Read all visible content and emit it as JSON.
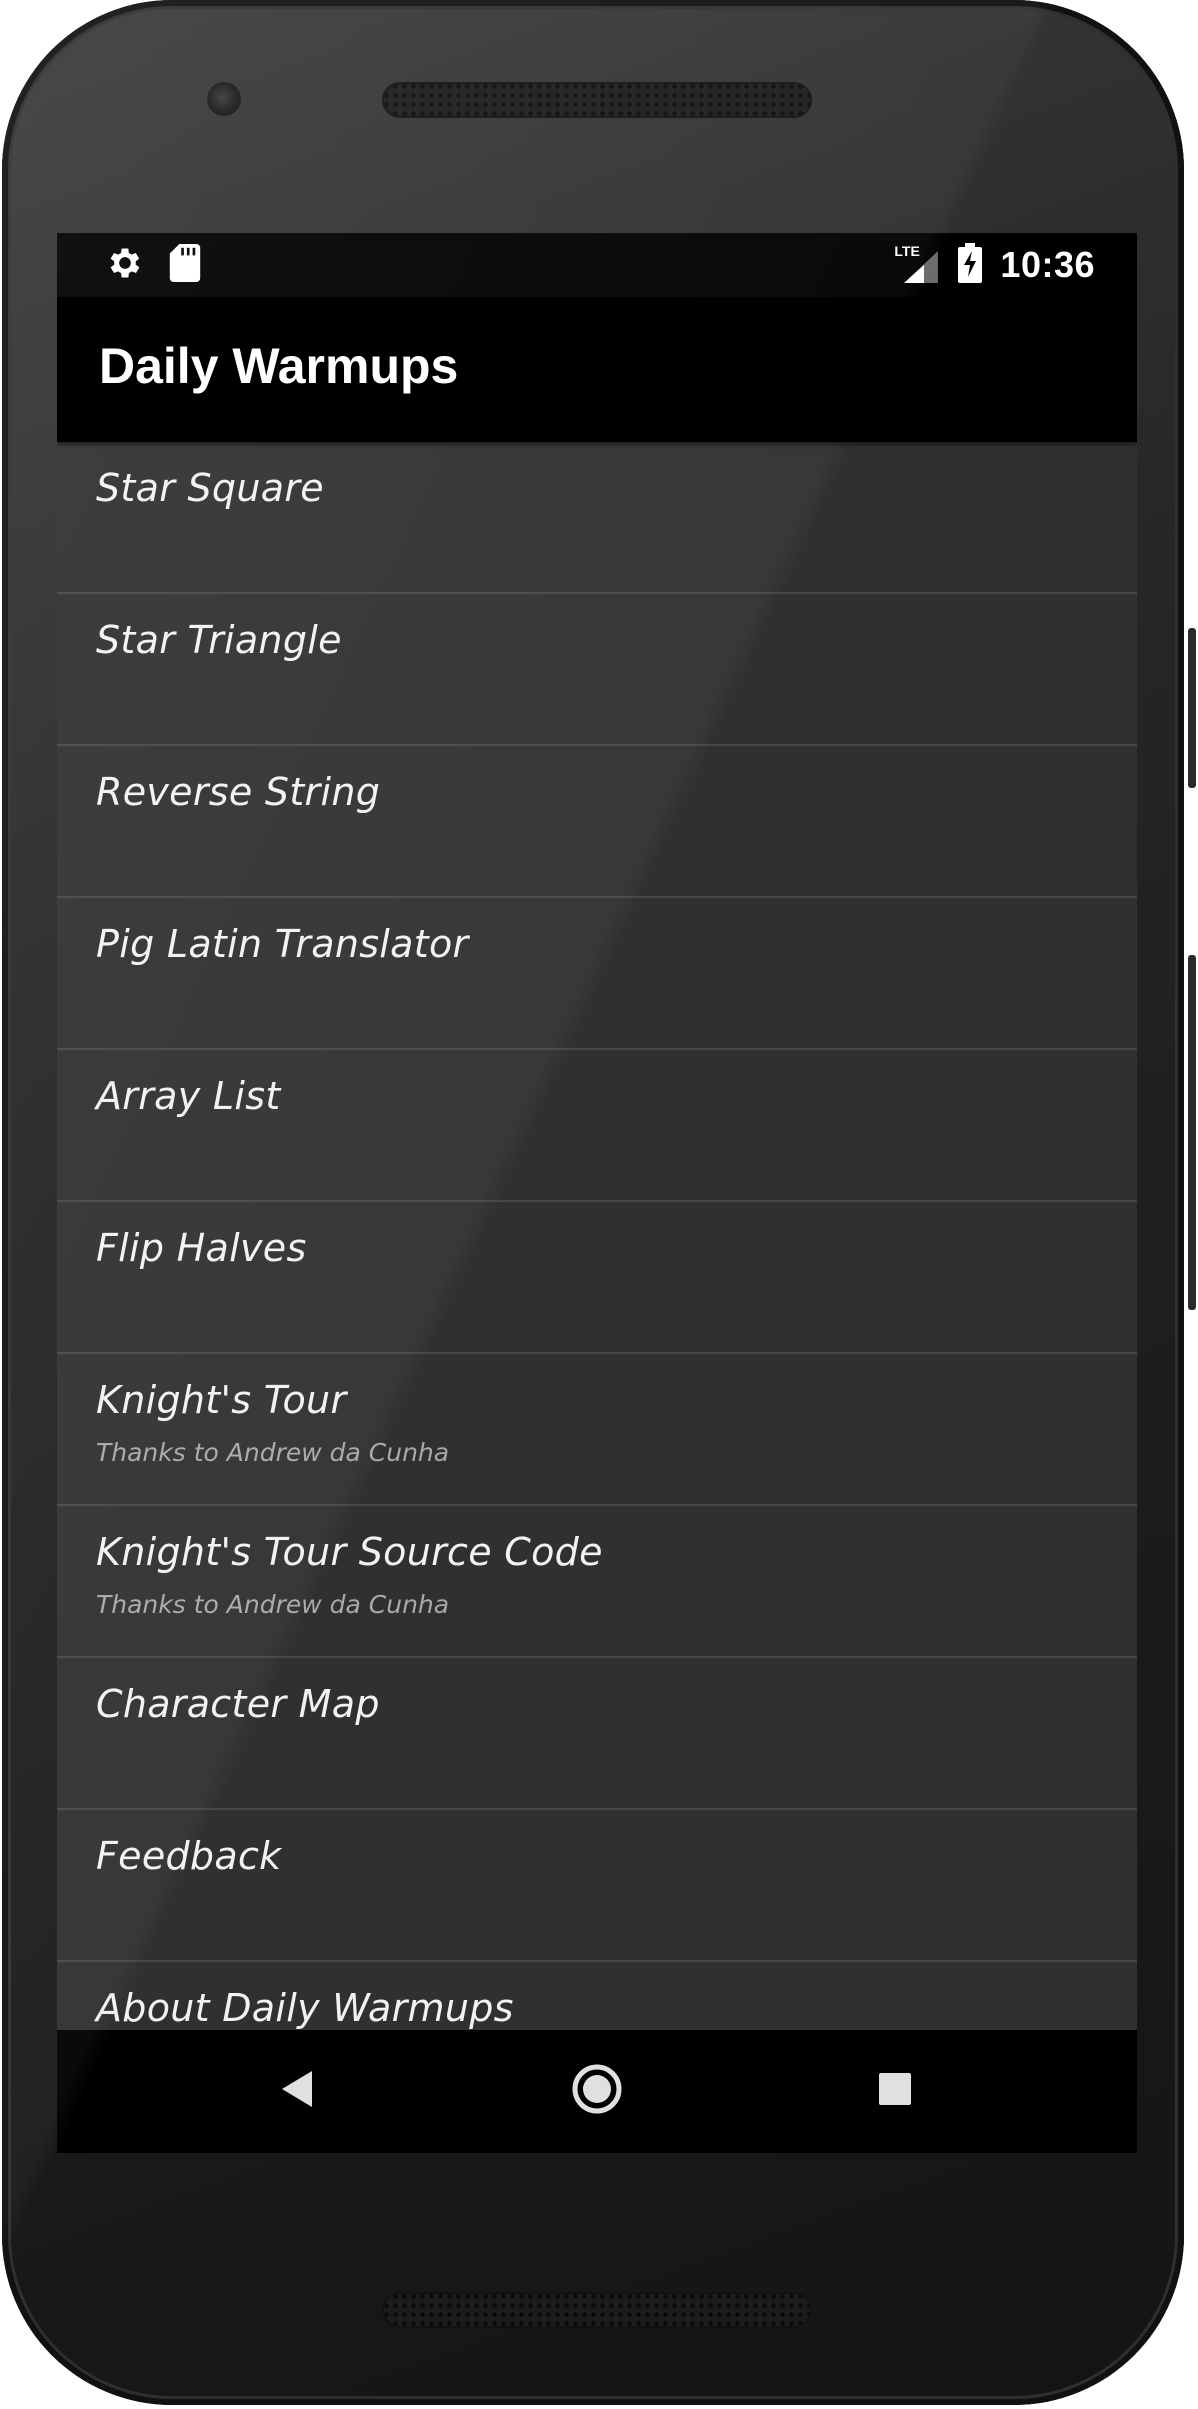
{
  "status_bar": {
    "time": "10:36",
    "network_label": "LTE",
    "left_icons": [
      "gear-icon",
      "sd-card-icon"
    ],
    "right_icons": [
      "signal-icon",
      "battery-charging-icon"
    ]
  },
  "app_bar": {
    "title": "Daily Warmups"
  },
  "list": {
    "items": [
      {
        "title": "Star Square",
        "subtitle": ""
      },
      {
        "title": "Star Triangle",
        "subtitle": ""
      },
      {
        "title": "Reverse String",
        "subtitle": ""
      },
      {
        "title": "Pig Latin Translator",
        "subtitle": ""
      },
      {
        "title": "Array List",
        "subtitle": ""
      },
      {
        "title": "Flip Halves",
        "subtitle": ""
      },
      {
        "title": "Knight's Tour",
        "subtitle": "Thanks to Andrew da Cunha"
      },
      {
        "title": "Knight's Tour Source Code",
        "subtitle": "Thanks to Andrew da Cunha"
      },
      {
        "title": "Character Map",
        "subtitle": ""
      },
      {
        "title": "Feedback",
        "subtitle": ""
      },
      {
        "title": "About Daily Warmups",
        "subtitle": ""
      }
    ]
  },
  "nav_bar": {
    "buttons": [
      "back-icon",
      "home-icon",
      "recents-icon"
    ]
  },
  "colors": {
    "background": "#303030",
    "app_bar": "#000000",
    "divider": "#474747",
    "text_primary": "#f2f2f2",
    "text_secondary": "#a8a8a8"
  }
}
